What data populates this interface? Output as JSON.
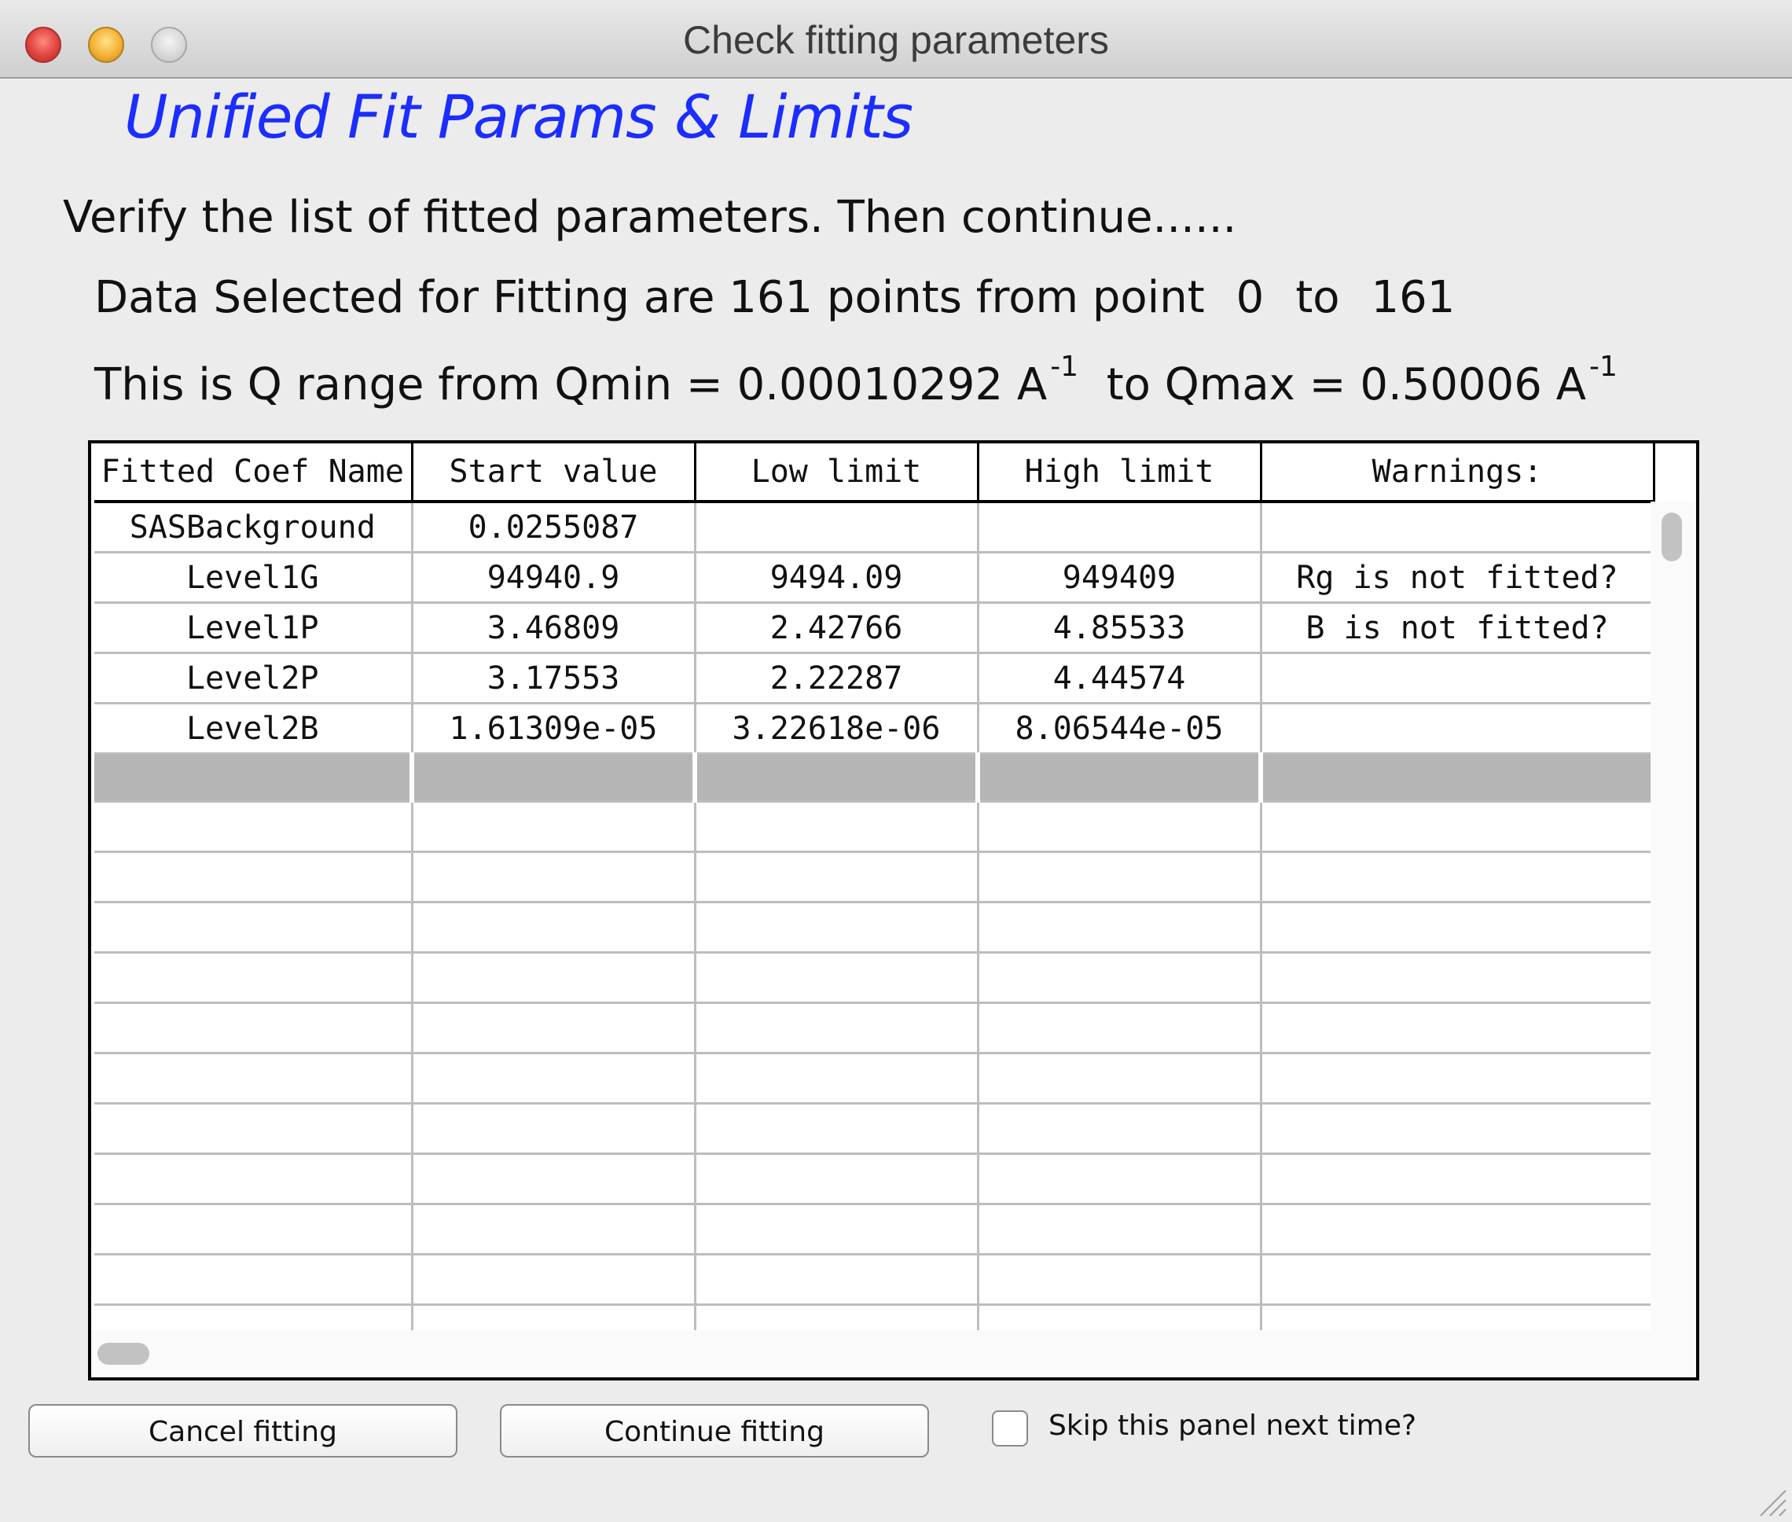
{
  "window": {
    "title": "Check fitting parameters"
  },
  "panel": {
    "heading": "Unified Fit Params & Limits",
    "instruction": "Verify the list of fitted parameters. Then continue......",
    "selection": {
      "prefix": "Data Selected for Fitting are 161 points from point",
      "from": "0",
      "to_word": "to",
      "to": "161"
    },
    "qrange": {
      "prefix": "This is Q range from Qmin = 0.00010292 A",
      "min_sup": "-1",
      "middle": "to  Qmax = 0.50006  A",
      "max_sup": "-1"
    }
  },
  "table": {
    "columns": [
      "Fitted Coef Name",
      "Start value",
      "Low limit",
      "High limit",
      "Warnings:"
    ],
    "rows": [
      [
        "SASBackground",
        "0.0255087",
        "",
        "",
        ""
      ],
      [
        "Level1G",
        "94940.9",
        "9494.09",
        "949409",
        "Rg is not fitted?"
      ],
      [
        "Level1P",
        "3.46809",
        "2.42766",
        "4.85533",
        "B is not fitted?"
      ],
      [
        "Level2P",
        "3.17553",
        "2.22287",
        "4.44574",
        ""
      ],
      [
        "Level2B",
        "1.61309e-05",
        "3.22618e-06",
        "8.06544e-05",
        ""
      ]
    ]
  },
  "buttons": {
    "cancel": "Cancel fitting",
    "continue": "Continue fitting"
  },
  "skip_checkbox": {
    "label": "Skip this panel next time?",
    "checked": false
  },
  "colors": {
    "heading": "#1b2dff",
    "separator_row": "#b5b5b5"
  }
}
